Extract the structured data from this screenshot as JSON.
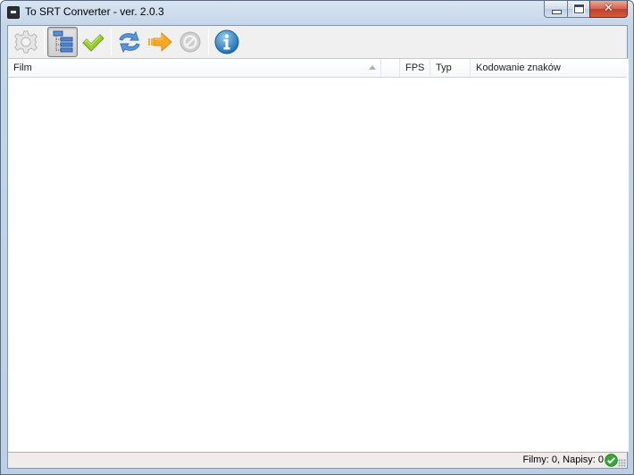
{
  "window": {
    "title": "To SRT Converter - ver. 2.0.3",
    "app_icon": "console-window-icon",
    "controls": {
      "minimize": "minimize-icon",
      "maximize": "maximize-icon",
      "close": "close-icon",
      "close_glyph": "✕"
    }
  },
  "toolbar": {
    "buttons": [
      {
        "id": "settings",
        "icon": "gear-icon",
        "state": "disabled"
      },
      {
        "id": "tree-view",
        "icon": "tree-list-icon",
        "state": "pressed"
      },
      {
        "id": "check",
        "icon": "checkmark-icon",
        "state": "enabled"
      },
      {
        "id": "refresh",
        "icon": "refresh-arrows-icon",
        "state": "enabled"
      },
      {
        "id": "convert",
        "icon": "arrow-right-icon",
        "state": "enabled"
      },
      {
        "id": "stop",
        "icon": "cancel-icon",
        "state": "disabled"
      },
      {
        "id": "info",
        "icon": "info-icon",
        "state": "enabled"
      }
    ]
  },
  "list": {
    "columns": [
      {
        "label": "Film",
        "sorted": "ascending"
      },
      {
        "label": ""
      },
      {
        "label": "FPS"
      },
      {
        "label": "Typ"
      },
      {
        "label": "Kodowanie znaków"
      }
    ],
    "rows": []
  },
  "statusbar": {
    "text": "Filmy: 0, Napisy: 0",
    "status_icon": "ok-check-icon",
    "status_color": "#3aa63a"
  }
}
